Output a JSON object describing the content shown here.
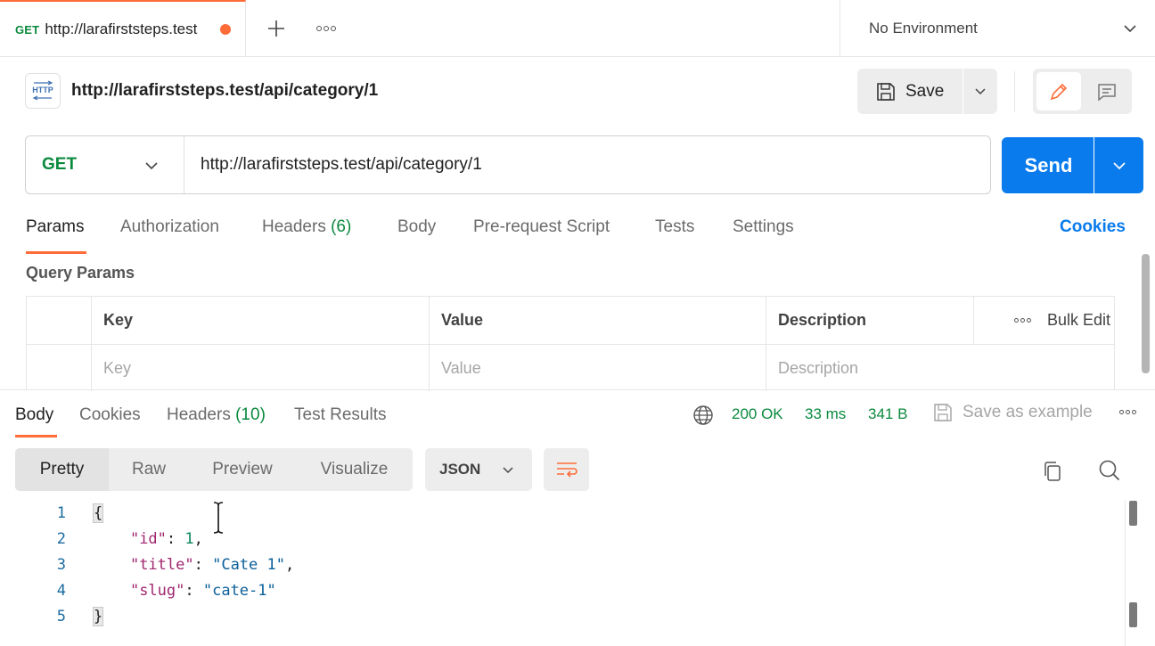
{
  "tabbar": {
    "tab": {
      "method": "GET",
      "title": "http://larafirststeps.test"
    },
    "environment": "No Environment"
  },
  "request": {
    "title": "http://larafirststeps.test/api/category/1",
    "save_label": "Save",
    "method": "GET",
    "url": "http://larafirststeps.test/api/category/1",
    "send_label": "Send",
    "tabs": [
      {
        "label": "Params"
      },
      {
        "label": "Authorization"
      },
      {
        "label": "Headers",
        "count": "(6)"
      },
      {
        "label": "Body"
      },
      {
        "label": "Pre-request Script"
      },
      {
        "label": "Tests"
      },
      {
        "label": "Settings"
      }
    ],
    "cookies_label": "Cookies",
    "query_params_title": "Query Params",
    "params_table": {
      "headers": [
        "Key",
        "Value",
        "Description"
      ],
      "bulk_edit": "Bulk Edit",
      "placeholders": {
        "key": "Key",
        "value": "Value",
        "description": "Description"
      }
    }
  },
  "response": {
    "tabs": [
      {
        "label": "Body"
      },
      {
        "label": "Cookies"
      },
      {
        "label": "Headers",
        "count": "(10)"
      },
      {
        "label": "Test Results"
      }
    ],
    "status": "200 OK",
    "time": "33 ms",
    "size": "341 B",
    "save_example": "Save as example",
    "view_modes": [
      "Pretty",
      "Raw",
      "Preview",
      "Visualize"
    ],
    "format": "JSON",
    "body_lines": [
      {
        "n": "1"
      },
      {
        "n": "2",
        "key": "\"id\"",
        "value": "1"
      },
      {
        "n": "3",
        "key": "\"title\"",
        "value": "\"Cate 1\""
      },
      {
        "n": "4",
        "key": "\"slug\"",
        "value": "\"cate-1\""
      },
      {
        "n": "5"
      }
    ]
  },
  "colors": {
    "accent": "#ff6c37",
    "primary": "#097bed",
    "success": "#0b8a3e"
  }
}
